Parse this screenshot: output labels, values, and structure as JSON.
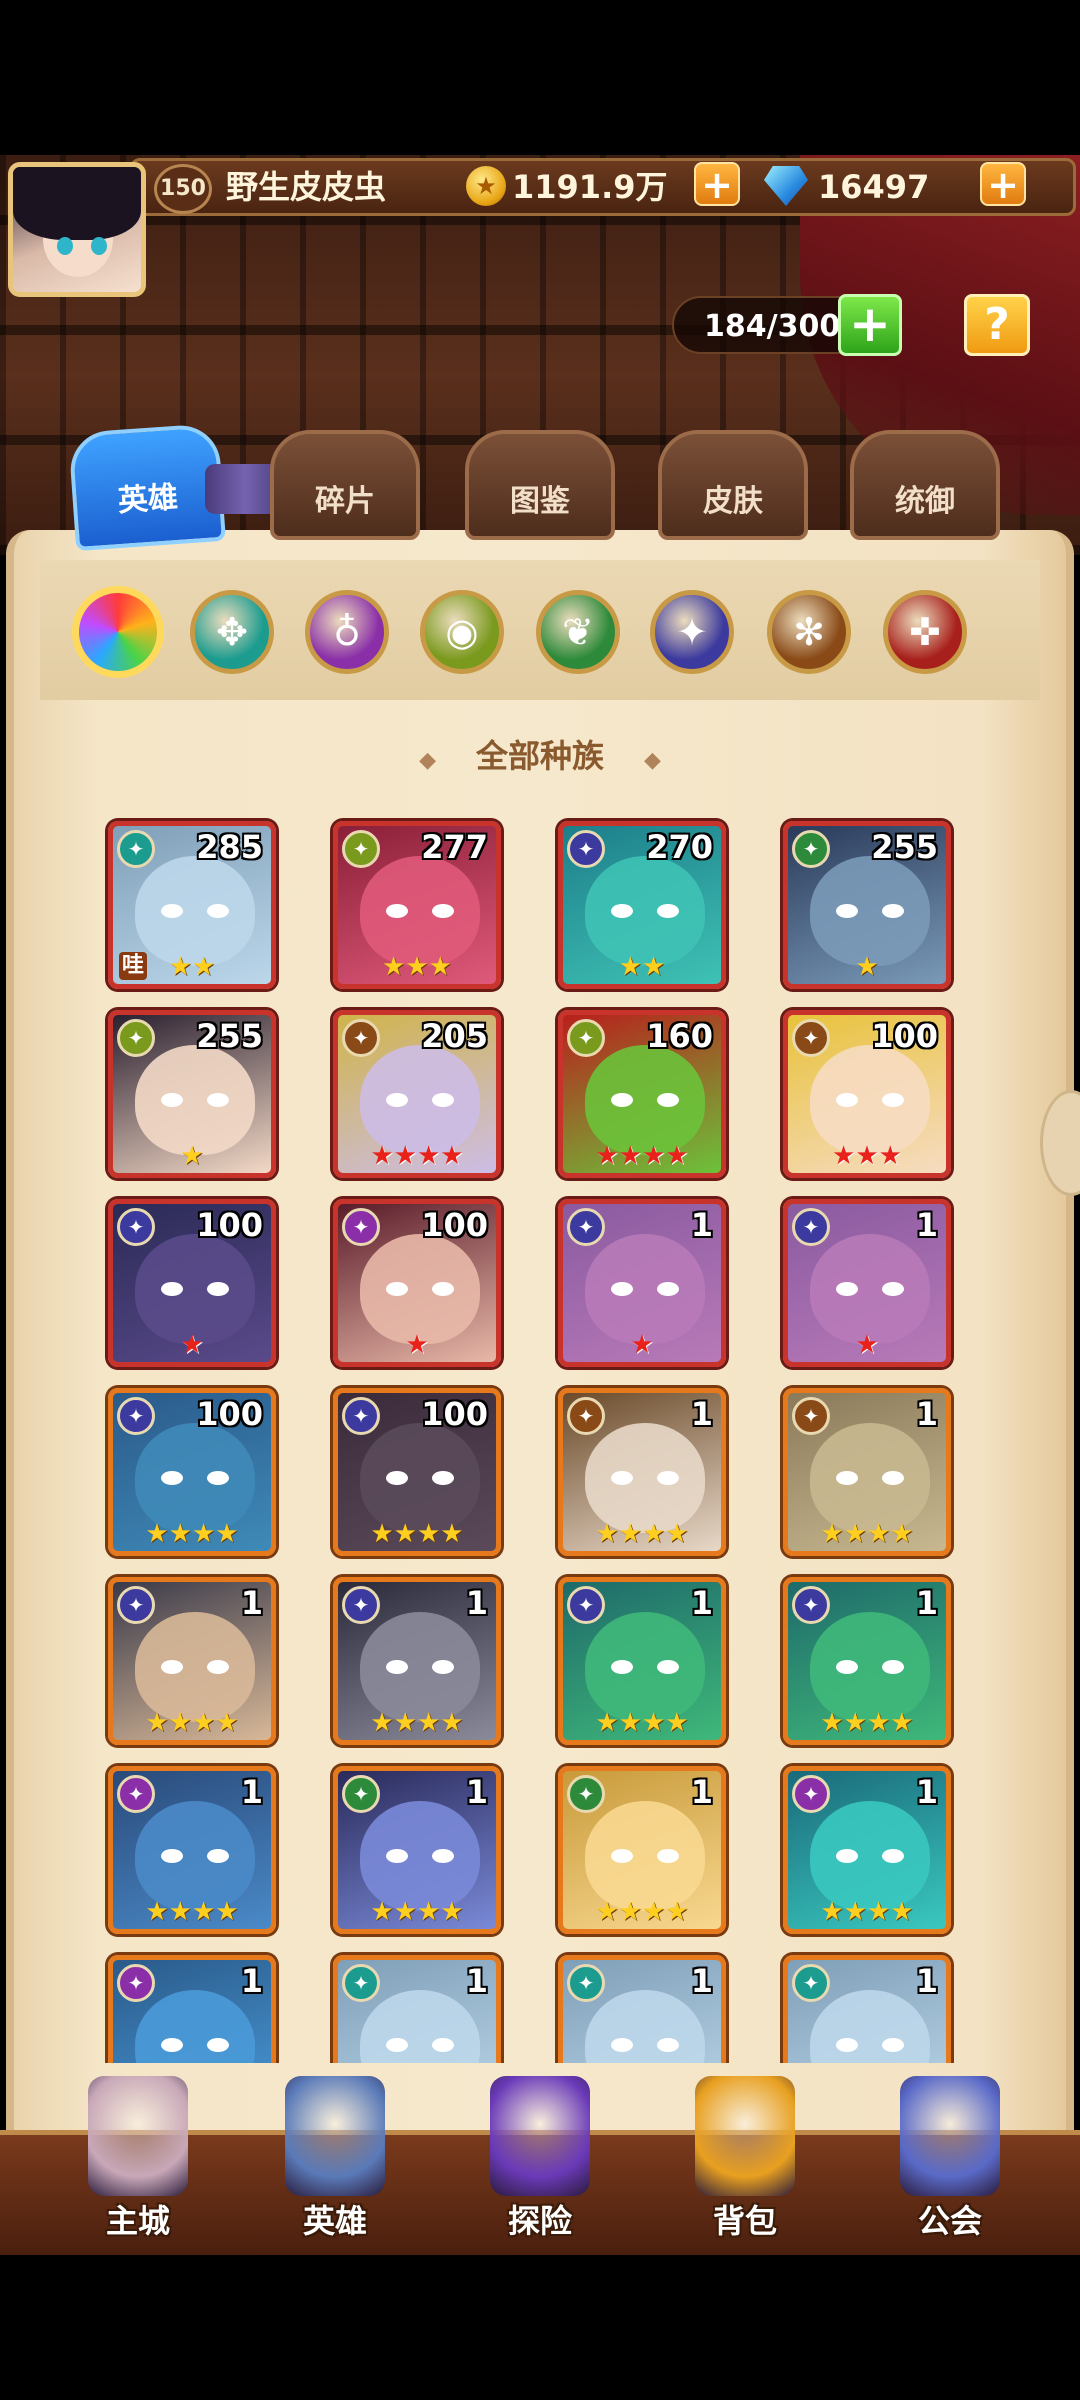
{
  "player": {
    "level": "150",
    "name": "野生皮皮虫"
  },
  "currency": {
    "gold": "1191.9万",
    "gems": "16497",
    "plus_glyph": "+"
  },
  "roster": {
    "capacity": "184/300",
    "add_glyph": "+",
    "help_glyph": "?"
  },
  "tabs": [
    {
      "label": "英雄",
      "active": true
    },
    {
      "label": "碎片",
      "active": false
    },
    {
      "label": "图鉴",
      "active": false
    },
    {
      "label": "皮肤",
      "active": false
    },
    {
      "label": "统御",
      "active": false
    }
  ],
  "race_filters": [
    {
      "name": "all-races",
      "color": "#ffd95c",
      "glyph": ""
    },
    {
      "name": "race-1",
      "color": "#1b9c8f",
      "glyph": "✥"
    },
    {
      "name": "race-2",
      "color": "#8a2fa8",
      "glyph": "♁"
    },
    {
      "name": "race-3",
      "color": "#7a9a1e",
      "glyph": "◉"
    },
    {
      "name": "race-4",
      "color": "#2d8a3a",
      "glyph": "❦"
    },
    {
      "name": "race-5",
      "color": "#3c3a9e",
      "glyph": "✦"
    },
    {
      "name": "race-6",
      "color": "#8a4a18",
      "glyph": "✻"
    },
    {
      "name": "race-7",
      "color": "#a8201c",
      "glyph": "✜"
    }
  ],
  "filter_title": "全部种族",
  "heroes": [
    {
      "level": "285",
      "stars": "★★",
      "star_type": "gold",
      "race_color": "#1b9c8f",
      "tag": "哇",
      "bg": "#7f9fb8",
      "face": "#bcd7ea",
      "frame": "red"
    },
    {
      "level": "277",
      "stars": "★★★",
      "star_type": "gold",
      "race_color": "#7a9a1e",
      "tag": "",
      "bg": "#8a1f38",
      "face": "#e05a7a",
      "frame": "red"
    },
    {
      "level": "270",
      "stars": "★★",
      "star_type": "gold",
      "race_color": "#3c3a9e",
      "tag": "",
      "bg": "#1d7e8a",
      "face": "#3fc2b5",
      "frame": "red"
    },
    {
      "level": "255",
      "stars": "★",
      "star_type": "gold",
      "race_color": "#2d8a3a",
      "tag": "",
      "bg": "#2a3a5a",
      "face": "#7a9ab8",
      "frame": "red"
    },
    {
      "level": "255",
      "stars": "★",
      "star_type": "gold",
      "race_color": "#7a9a1e",
      "tag": "",
      "bg": "#2a2030",
      "face": "#f3d9c6",
      "frame": "red"
    },
    {
      "level": "205",
      "stars": "★★★★",
      "star_type": "red",
      "race_color": "#8a4a18",
      "tag": "",
      "bg": "#d0b44a",
      "face": "#cdbde6",
      "frame": "red"
    },
    {
      "level": "160",
      "stars": "★★★★",
      "star_type": "red",
      "race_color": "#7a9a1e",
      "tag": "",
      "bg": "#b8201c",
      "face": "#6cc23a",
      "frame": "red"
    },
    {
      "level": "100",
      "stars": "★★★",
      "star_type": "red",
      "race_color": "#8a4a18",
      "tag": "",
      "bg": "#e8c23a",
      "face": "#f6dcc2",
      "frame": "red"
    },
    {
      "level": "100",
      "stars": "★",
      "star_type": "red",
      "race_color": "#3c3a9e",
      "tag": "",
      "bg": "#2a2a56",
      "face": "#5a4a8a",
      "frame": "red"
    },
    {
      "level": "100",
      "stars": "★",
      "star_type": "red",
      "race_color": "#8a2fa8",
      "tag": "",
      "bg": "#5a1c2a",
      "face": "#e8b8a8",
      "frame": "red"
    },
    {
      "level": "1",
      "stars": "★",
      "star_type": "red",
      "race_color": "#3c3a9e",
      "tag": "",
      "bg": "#8a5aa0",
      "face": "#b87ab8",
      "frame": "red"
    },
    {
      "level": "1",
      "stars": "★",
      "star_type": "red",
      "race_color": "#3c3a9e",
      "tag": "",
      "bg": "#8a5aa0",
      "face": "#b87ab8",
      "frame": "red"
    },
    {
      "level": "100",
      "stars": "★★★★",
      "star_type": "gold",
      "race_color": "#3c3a9e",
      "tag": "",
      "bg": "#2a5a8a",
      "face": "#3f8ab8",
      "frame": "orange"
    },
    {
      "level": "100",
      "stars": "★★★★",
      "star_type": "gold",
      "race_color": "#3c3a9e",
      "tag": "",
      "bg": "#3a2a3a",
      "face": "#5a4a5a",
      "frame": "orange"
    },
    {
      "level": "1",
      "stars": "★★★★",
      "star_type": "gold",
      "race_color": "#8a4a18",
      "tag": "",
      "bg": "#6a4a2a",
      "face": "#e8d8c8",
      "frame": "orange"
    },
    {
      "level": "1",
      "stars": "★★★★",
      "star_type": "gold",
      "race_color": "#8a4a18",
      "tag": "",
      "bg": "#8a7a5a",
      "face": "#c8b890",
      "frame": "orange"
    },
    {
      "level": "1",
      "stars": "★★★★",
      "star_type": "gold",
      "race_color": "#3c3a9e",
      "tag": "",
      "bg": "#3a3a4a",
      "face": "#d8b898",
      "frame": "orange"
    },
    {
      "level": "1",
      "stars": "★★★★",
      "star_type": "gold",
      "race_color": "#3c3a9e",
      "tag": "",
      "bg": "#2a2a3a",
      "face": "#8a8a9a",
      "frame": "orange"
    },
    {
      "level": "1",
      "stars": "★★★★",
      "star_type": "gold",
      "race_color": "#3c3a9e",
      "tag": "",
      "bg": "#1e6a6a",
      "face": "#3fb87a",
      "frame": "orange"
    },
    {
      "level": "1",
      "stars": "★★★★",
      "star_type": "gold",
      "race_color": "#3c3a9e",
      "tag": "",
      "bg": "#1e6a6a",
      "face": "#3fb87a",
      "frame": "orange"
    },
    {
      "level": "1",
      "stars": "★★★★",
      "star_type": "gold",
      "race_color": "#8a2fa8",
      "tag": "",
      "bg": "#2a4a7a",
      "face": "#4a8ac8",
      "frame": "orange"
    },
    {
      "level": "1",
      "stars": "★★★★",
      "star_type": "gold",
      "race_color": "#2d8a3a",
      "tag": "",
      "bg": "#2a2a5a",
      "face": "#7a8ad8",
      "frame": "orange"
    },
    {
      "level": "1",
      "stars": "★★★★",
      "star_type": "gold",
      "race_color": "#2d8a3a",
      "tag": "",
      "bg": "#c89a3a",
      "face": "#f8d890",
      "frame": "orange"
    },
    {
      "level": "1",
      "stars": "★★★★",
      "star_type": "gold",
      "race_color": "#8a2fa8",
      "tag": "",
      "bg": "#1a6a7a",
      "face": "#3ac8c0",
      "frame": "orange"
    },
    {
      "level": "1",
      "stars": "",
      "star_type": "gold",
      "race_color": "#8a2fa8",
      "tag": "",
      "bg": "#2a5a8a",
      "face": "#4a9ad8",
      "frame": "orange"
    },
    {
      "level": "1",
      "stars": "",
      "star_type": "gold",
      "race_color": "#1b9c8f",
      "tag": "",
      "bg": "#7f9fb8",
      "face": "#bcd7ea",
      "frame": "orange"
    },
    {
      "level": "1",
      "stars": "",
      "star_type": "gold",
      "race_color": "#1b9c8f",
      "tag": "",
      "bg": "#7f9fb8",
      "face": "#bcd7ea",
      "frame": "orange"
    },
    {
      "level": "1",
      "stars": "",
      "star_type": "gold",
      "race_color": "#1b9c8f",
      "tag": "",
      "bg": "#7f9fb8",
      "face": "#bcd7ea",
      "frame": "orange"
    }
  ],
  "nav": [
    {
      "label": "主城",
      "icon": "castle-icon",
      "color": "#c8a8b8"
    },
    {
      "label": "英雄",
      "icon": "hero-icon",
      "color": "#5a7ab8"
    },
    {
      "label": "探险",
      "icon": "portal-icon",
      "color": "#6a3ab8"
    },
    {
      "label": "背包",
      "icon": "backpack-icon",
      "color": "#e8a020"
    },
    {
      "label": "公会",
      "icon": "guild-icon",
      "color": "#5a6ac8"
    }
  ]
}
